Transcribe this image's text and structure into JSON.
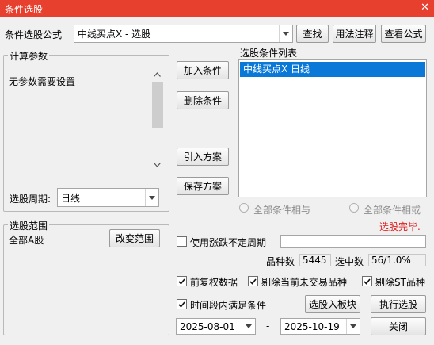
{
  "window": {
    "title": "条件选股",
    "close_glyph": "✕"
  },
  "formula": {
    "label": "条件选股公式",
    "value": "中线买点X  -  选股"
  },
  "buttons": {
    "find": "查找",
    "usage": "用法注释",
    "view": "查看公式",
    "add": "加入条件",
    "remove": "删除条件",
    "import": "引入方案",
    "save": "保存方案",
    "change_range": "改变范围",
    "into_block": "选股入板块",
    "execute": "执行选股",
    "close": "关闭"
  },
  "params": {
    "legend": "计算参数",
    "message": "无参数需要设置",
    "period_label": "选股周期:",
    "period_value": "日线"
  },
  "conditions": {
    "legend": "选股条件列表",
    "items": [
      "中线买点X  日线"
    ]
  },
  "logic": {
    "and_label": "全部条件相与",
    "or_label": "全部条件相或"
  },
  "status": {
    "text": "选股完毕.",
    "color": "#e02020"
  },
  "range": {
    "legend": "选股范围",
    "value": "全部A股"
  },
  "uncertain_period": {
    "label": "使用涨跌不定周期",
    "value": "",
    "checked": false
  },
  "stats": {
    "count_label": "品种数",
    "count_value": "5445",
    "selected_label": "选中数",
    "selected_value": "56/1.0%"
  },
  "options": {
    "adjusted": {
      "label": "前复权数据",
      "checked": true
    },
    "exclude_untraded": {
      "label": "剔除当前未交易品种",
      "checked": true
    },
    "exclude_st": {
      "label": "剔除ST品种",
      "checked": true
    },
    "time_range": {
      "label": "时间段内满足条件",
      "checked": true
    }
  },
  "dates": {
    "start": "2025-08-01",
    "separator": "-",
    "end": "2025-10-19"
  },
  "colors": {
    "titlebar": "#e8402f",
    "selection": "#0a78d7"
  }
}
